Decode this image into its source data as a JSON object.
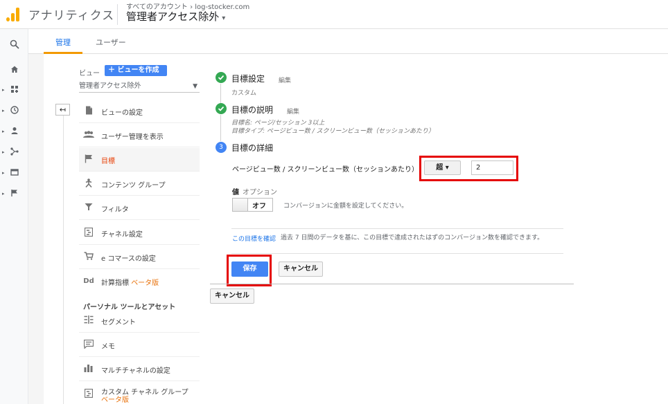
{
  "header": {
    "app_name": "アナリティクス",
    "breadcrumb_all": "すべてのアカウント",
    "breadcrumb_sep": "›",
    "breadcrumb_site": "log-stocker.com",
    "view_title": "管理者アクセス除外",
    "view_caret": "▾",
    "brand_color": "#f9ab00"
  },
  "rail": {
    "icons": [
      "search-icon",
      "home-icon",
      "dashboard-icon",
      "clock-icon",
      "person-icon",
      "acquisition-icon",
      "behavior-icon",
      "flag-icon"
    ]
  },
  "tabs": [
    {
      "label": "管理",
      "active": true
    },
    {
      "label": "ユーザー",
      "active": false
    }
  ],
  "view": {
    "label": "ビュー",
    "create_button": "＋ ビューを作成",
    "selected_view": "管理者アクセス除外",
    "back_arrow": "↤"
  },
  "menu": [
    {
      "label": "ビューの設定",
      "icon": "document-icon"
    },
    {
      "label": "ユーザー管理を表示",
      "icon": "people-icon"
    },
    {
      "label": "目標",
      "icon": "flag-icon",
      "selected": true
    },
    {
      "label": "コンテンツ グループ",
      "icon": "content-group-icon"
    },
    {
      "label": "フィルタ",
      "icon": "filter-icon"
    },
    {
      "label": "チャネル設定",
      "icon": "channel-icon"
    },
    {
      "label": "e コマースの設定",
      "icon": "cart-icon"
    },
    {
      "label": "計算指標",
      "beta": "ベータ版",
      "icon": "dd-icon"
    }
  ],
  "section_personal": "パーソナル ツールとアセット",
  "menu2": [
    {
      "label": "セグメント",
      "icon": "segment-icon"
    },
    {
      "label": "メモ",
      "icon": "memo-icon"
    },
    {
      "label": "マルチチャネルの設定",
      "icon": "bar-chart-icon"
    },
    {
      "label": "カスタム チャネル グループ",
      "beta": "ベータ版",
      "icon": "custom-channel-icon"
    }
  ],
  "steps": {
    "step1": {
      "title": "目標設定",
      "edit": "編集",
      "sub": "カスタム"
    },
    "step2": {
      "title": "目標の説明",
      "edit": "編集",
      "sub1": "目標名: ページ/セッション 3以上",
      "sub2": "目標タイプ: ページビュー数 / スクリーンビュー数（セッションあたり）"
    },
    "step3": {
      "number": "3",
      "title": "目標の詳細"
    }
  },
  "details": {
    "condition_label": "ページビュー数 / スクリーンビュー数（セッションあたり）",
    "operator": "超 ▾",
    "value": "2",
    "value_label": "値",
    "option_label": "オプション",
    "toggle_label": "オフ",
    "value_desc": "コンバージョンに金額を設定してください。",
    "verify_link": "この目標を確認",
    "verify_desc": "過去 7 日間のデータを基に、この目標で達成されたはずのコンバージョン数を確認できます。",
    "save": "保存",
    "cancel": "キャンセル",
    "outer_cancel": "キャンセル"
  },
  "colors": {
    "accent": "#4285f4",
    "check": "#34a853",
    "highlight": "#e50000",
    "selected_text": "#e8430a"
  }
}
